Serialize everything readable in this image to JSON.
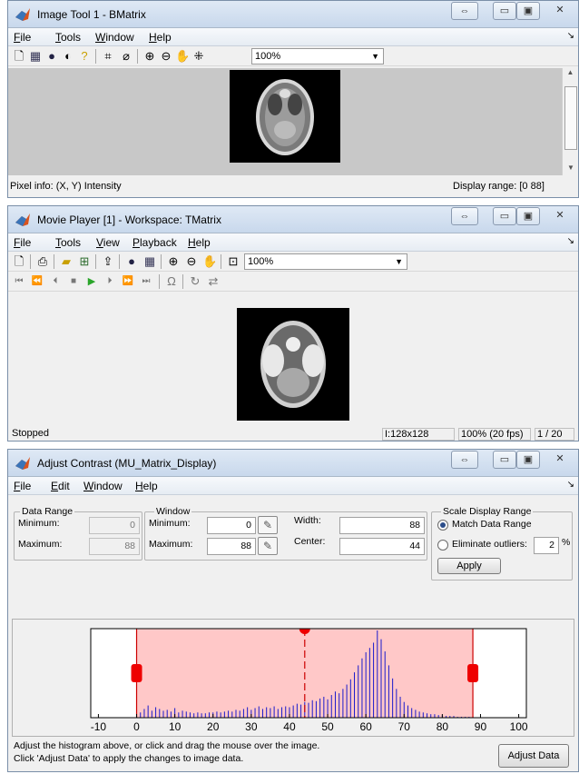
{
  "image_tool": {
    "title": "Image Tool 1 - BMatrix",
    "menu": [
      "File",
      "Tools",
      "Window",
      "Help"
    ],
    "zoom": "100%",
    "pixel_info": "Pixel info: (X, Y)  Intensity",
    "display_range": "Display range: [0 88]"
  },
  "movie_player": {
    "title": "Movie Player [1] - Workspace: TMatrix",
    "menu": [
      "File",
      "Tools",
      "View",
      "Playback",
      "Help"
    ],
    "zoom": "100%",
    "status": "Stopped",
    "size": "I:128x128",
    "rate": "100% (20 fps)",
    "frame": "1 / 20"
  },
  "adjust_contrast": {
    "title": "Adjust Contrast (MU_Matrix_Display)",
    "menu": [
      "File",
      "Edit",
      "Window",
      "Help"
    ],
    "data_range": {
      "legend": "Data Range",
      "min_label": "Minimum:",
      "min_value": "0",
      "max_label": "Maximum:",
      "max_value": "88"
    },
    "window": {
      "legend": "Window",
      "min_label": "Minimum:",
      "min_value": "0",
      "max_label": "Maximum:",
      "max_value": "88",
      "width_label": "Width:",
      "width_value": "88",
      "center_label": "Center:",
      "center_value": "44"
    },
    "scale": {
      "legend": "Scale Display Range",
      "match_label": "Match Data Range",
      "elim_label": "Eliminate outliers:",
      "elim_value": "2",
      "pct": "%",
      "apply": "Apply"
    },
    "hint_line1": "Adjust the histogram above, or click and drag the mouse over the image.",
    "hint_line2": "Click 'Adjust Data' to apply the changes to image data.",
    "adjust_button": "Adjust Data"
  },
  "chart_data": {
    "type": "bar",
    "xlim": [
      -12,
      102
    ],
    "window": [
      0,
      88
    ],
    "center": 44,
    "tick_labels": [
      "-10",
      "0",
      "10",
      "20",
      "30",
      "40",
      "50",
      "60",
      "70",
      "80",
      "90",
      "100"
    ],
    "tick_values": [
      -10,
      0,
      10,
      20,
      30,
      40,
      50,
      60,
      70,
      80,
      90,
      100
    ],
    "x": [
      0,
      1,
      2,
      3,
      4,
      5,
      6,
      7,
      8,
      9,
      10,
      11,
      12,
      13,
      14,
      15,
      16,
      17,
      18,
      19,
      20,
      21,
      22,
      23,
      24,
      25,
      26,
      27,
      28,
      29,
      30,
      31,
      32,
      33,
      34,
      35,
      36,
      37,
      38,
      39,
      40,
      41,
      42,
      43,
      44,
      45,
      46,
      47,
      48,
      49,
      50,
      51,
      52,
      53,
      54,
      55,
      56,
      57,
      58,
      59,
      60,
      61,
      62,
      63,
      64,
      65,
      66,
      67,
      68,
      69,
      70,
      71,
      72,
      73,
      74,
      75,
      76,
      77,
      78,
      79,
      80,
      81,
      82,
      83,
      84,
      85,
      86,
      87,
      88
    ],
    "values": [
      2,
      6,
      10,
      14,
      8,
      12,
      10,
      8,
      9,
      7,
      11,
      6,
      8,
      7,
      6,
      5,
      6,
      5,
      5,
      6,
      6,
      7,
      6,
      7,
      8,
      7,
      9,
      8,
      10,
      12,
      9,
      11,
      13,
      10,
      12,
      11,
      13,
      10,
      12,
      13,
      12,
      14,
      16,
      15,
      18,
      17,
      20,
      19,
      22,
      24,
      21,
      26,
      30,
      28,
      33,
      38,
      44,
      52,
      60,
      68,
      75,
      80,
      86,
      100,
      90,
      76,
      60,
      45,
      33,
      24,
      18,
      14,
      11,
      9,
      7,
      6,
      5,
      4,
      4,
      3,
      3,
      2,
      2,
      2,
      1,
      1,
      1,
      1,
      1
    ]
  }
}
